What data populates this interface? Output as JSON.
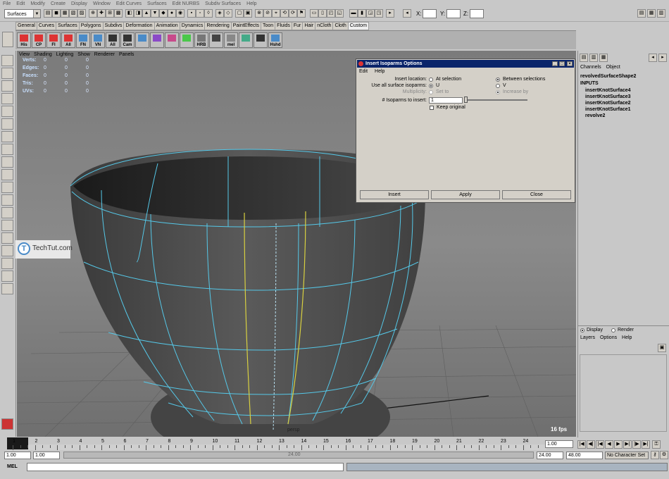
{
  "menubar": [
    "File",
    "Edit",
    "Modify",
    "Create",
    "Display",
    "Window",
    "Edit Curves",
    "Surfaces",
    "Edit NURBS",
    "Subdiv Surfaces",
    "Help"
  ],
  "mode_select": "Surfaces",
  "coords": {
    "x_label": "X:",
    "y_label": "Y:",
    "z_label": "Z:"
  },
  "shelf_tabs": [
    "General",
    "Curves",
    "Surfaces",
    "Polygons",
    "Subdivs",
    "Deformation",
    "Animation",
    "Dynamics",
    "Rendering",
    "PaintEffects",
    "Toon",
    "Fluids",
    "Fur",
    "Hair",
    "nCloth",
    "Cloth",
    "Custom"
  ],
  "shelf_items": [
    "His",
    "CP",
    "FI",
    "All",
    "FN",
    "VN",
    "All",
    "Cam",
    "",
    "",
    "",
    "",
    "HRB",
    "",
    "mel",
    "",
    "",
    "Hshd"
  ],
  "viewport_menu": [
    "View",
    "Shading",
    "Lighting",
    "Show",
    "Renderer",
    "Panels"
  ],
  "hud": {
    "rows": [
      "Verts:",
      "Edges:",
      "Faces:",
      "Tris:",
      "UVs:"
    ],
    "values": [
      "0",
      "0",
      "0"
    ]
  },
  "viewport": {
    "fps": "16 fps",
    "camera": "persp"
  },
  "watermark": {
    "text": "TechTut.com",
    "letter": "T"
  },
  "dialog": {
    "title": "Insert Isoparms Options",
    "menu": [
      "Edit",
      "Help"
    ],
    "insert_location_label": "Insert location:",
    "insert_location_opt1": "At selection",
    "insert_location_opt2": "Between selections",
    "use_all_label": "Use all surface isoparms:",
    "use_all_opt1": "U",
    "use_all_opt2": "V",
    "multiplicity_label": "Multiplicity:",
    "multiplicity_opt1": "Set to",
    "multiplicity_opt2": "Increase by",
    "isoparms_label": "# Isoparms to insert:",
    "isoparms_value": "1",
    "keep_original": "Keep original",
    "buttons": [
      "Insert",
      "Apply",
      "Close"
    ]
  },
  "channel_box": {
    "menu": [
      "Channels",
      "Object"
    ],
    "node": "revolvedSurfaceShape2",
    "inputs_label": "INPUTS",
    "inputs": [
      "insertKnotSurface4",
      "insertKnotSurface3",
      "insertKnotSurface2",
      "insertKnotSurface1",
      "revolve2"
    ]
  },
  "layer_panel": {
    "display": "Display",
    "render": "Render",
    "menu": [
      "Layers",
      "Options",
      "Help"
    ]
  },
  "timeline": {
    "ticks": [
      "1",
      "2",
      "3",
      "4",
      "5",
      "6",
      "7",
      "8",
      "9",
      "10",
      "11",
      "12",
      "13",
      "14",
      "15",
      "16",
      "17",
      "18",
      "19",
      "20",
      "21",
      "22",
      "23",
      "24"
    ],
    "current": "1.00"
  },
  "range": {
    "start": "1.00",
    "start2": "1.00",
    "slider_label": "24.00",
    "end": "24.00",
    "end2": "48.00",
    "character_set": "No Character Set"
  },
  "command": {
    "label": "MEL"
  }
}
